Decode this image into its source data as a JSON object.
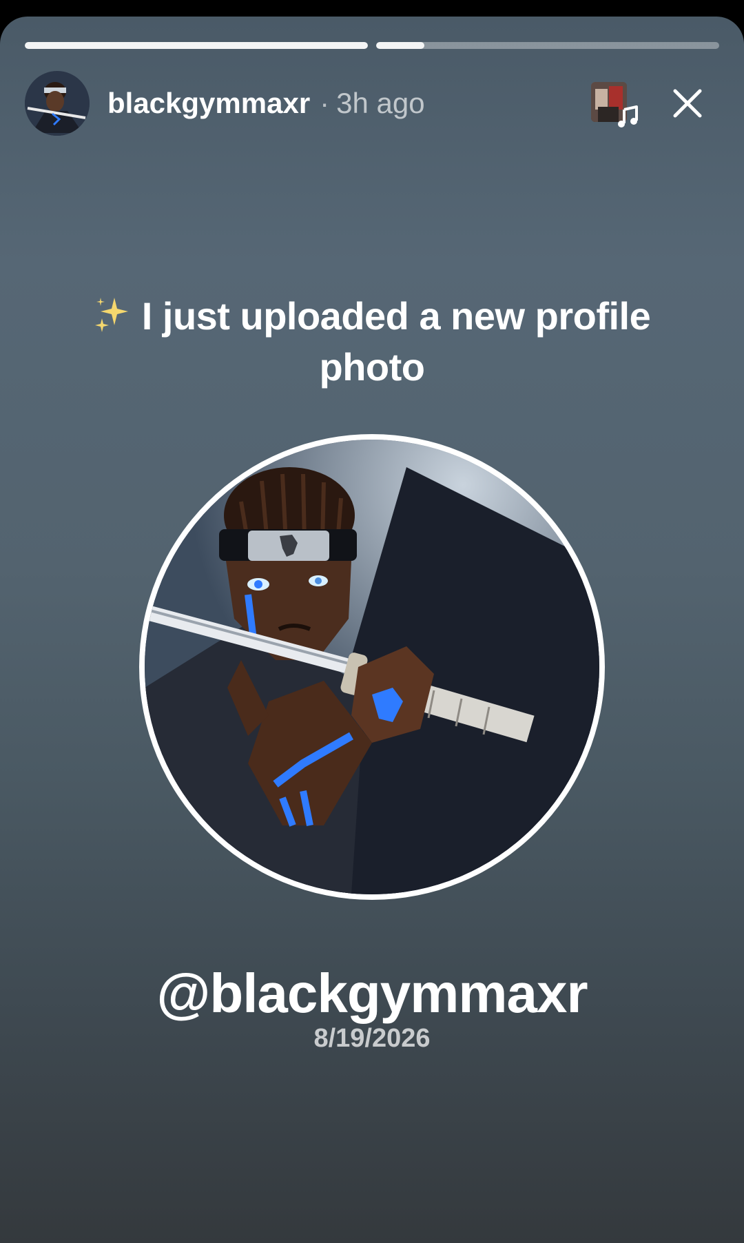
{
  "story": {
    "progress": [
      1.0,
      0.14
    ],
    "username": "blackgymmaxr",
    "separator": "·",
    "time_ago": "3h ago",
    "music_icon": "music-note-icon",
    "close_icon": "close-icon"
  },
  "caption": {
    "sparkle_icon": "sparkles-icon",
    "text": "I just uploaded a new profile photo"
  },
  "profile_card": {
    "handle": "@blackgymmaxr",
    "date": "8/19/2026"
  },
  "colors": {
    "accent_blue": "#2f7bff",
    "sparkle_yellow": "#f5d76e"
  }
}
